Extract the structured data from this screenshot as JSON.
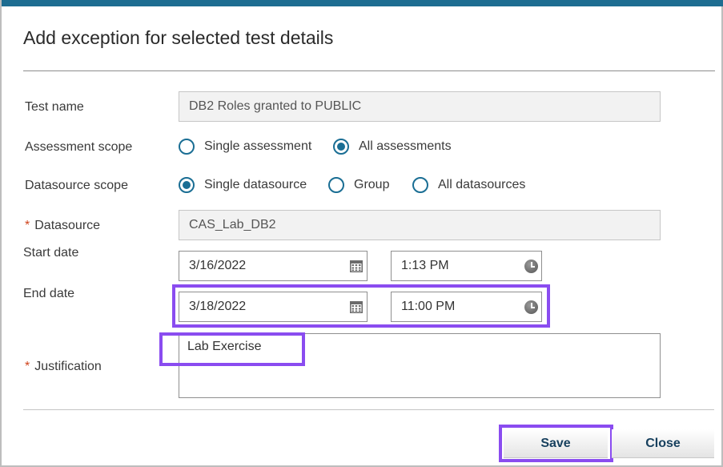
{
  "dialog": {
    "title": "Add exception for selected test details"
  },
  "form": {
    "test_name": {
      "label": "Test name",
      "value": "DB2 Roles granted to PUBLIC"
    },
    "assessment_scope": {
      "label": "Assessment scope",
      "options": [
        "Single assessment",
        "All assessments"
      ],
      "selected": "All assessments"
    },
    "datasource_scope": {
      "label": "Datasource scope",
      "options": [
        "Single datasource",
        "Group",
        "All datasources"
      ],
      "selected": "Single datasource"
    },
    "datasource": {
      "required_mark": "*",
      "label": "Datasource",
      "value": "CAS_Lab_DB2"
    },
    "start_date": {
      "label": "Start date",
      "date": "3/16/2022",
      "time": "1:13 PM"
    },
    "end_date": {
      "label": "End date",
      "date": "3/18/2022",
      "time": "11:00 PM"
    },
    "justification": {
      "required_mark": "*",
      "label": "Justification",
      "value": "Lab Exercise"
    }
  },
  "buttons": {
    "save": "Save",
    "close": "Close"
  },
  "colors": {
    "accent_bar": "#1d6d91",
    "radio": "#1a6e94",
    "highlight": "#8a4cf0",
    "required": "#d0431c"
  },
  "icons": [
    "calendar-icon",
    "clock-icon"
  ]
}
